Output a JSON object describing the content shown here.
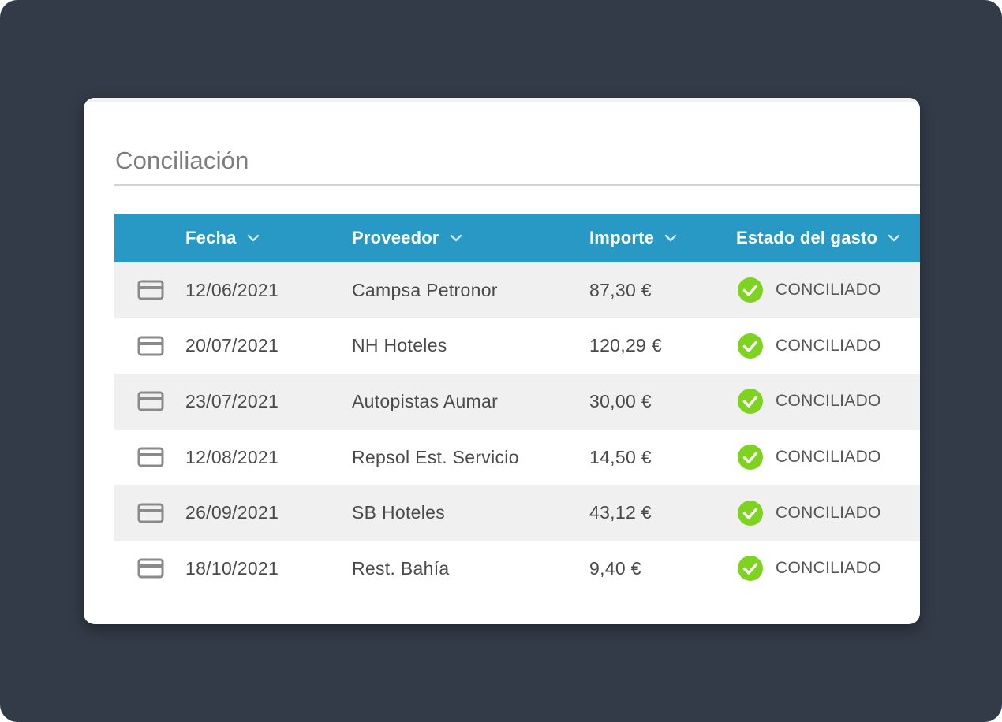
{
  "panel": {
    "title": "Conciliación"
  },
  "table": {
    "columns": [
      {
        "label": "Fecha"
      },
      {
        "label": "Proveedor"
      },
      {
        "label": "Importe"
      },
      {
        "label": "Estado del gasto"
      }
    ],
    "rows": [
      {
        "date": "12/06/2021",
        "provider": "Campsa Petronor",
        "amount": "87,30 €",
        "status": "CONCILIADO"
      },
      {
        "date": "20/07/2021",
        "provider": "NH Hoteles",
        "amount": "120,29 €",
        "status": "CONCILIADO"
      },
      {
        "date": "23/07/2021",
        "provider": "Autopistas Aumar",
        "amount": "30,00 €",
        "status": "CONCILIADO"
      },
      {
        "date": "12/08/2021",
        "provider": "Repsol Est. Servicio",
        "amount": "14,50 €",
        "status": "CONCILIADO"
      },
      {
        "date": "26/09/2021",
        "provider": "SB Hoteles",
        "amount": "43,12 €",
        "status": "CONCILIADO"
      },
      {
        "date": "18/10/2021",
        "provider": "Rest. Bahía",
        "amount": "9,40 €",
        "status": "CONCILIADO"
      }
    ]
  },
  "icons": {
    "row_icon": "credit-card-icon",
    "sort_icon": "chevron-down-icon",
    "status_icon": "check-circle-icon"
  },
  "colors": {
    "header_bg": "#2799c4",
    "status_ok": "#7ed321",
    "backdrop": "#323b47"
  }
}
